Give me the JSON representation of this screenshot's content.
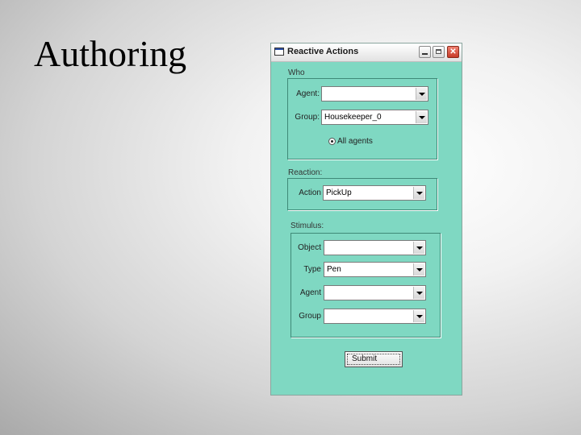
{
  "slide": {
    "title": "Authoring"
  },
  "window": {
    "title": "Reactive Actions",
    "controls": {
      "minimize": "–",
      "maximize": "□",
      "close": "✕"
    }
  },
  "who": {
    "label": "Who",
    "agent_label": "Agent:",
    "agent_value": "",
    "group_label": "Group:",
    "group_value": "Housekeeper_0",
    "all_agents_label": "All agents"
  },
  "reaction": {
    "label": "Reaction:",
    "action_label": "Action",
    "action_value": "PickUp"
  },
  "stimulus": {
    "label": "Stimulus:",
    "object_label": "Object",
    "object_value": "",
    "type_label": "Type",
    "type_value": "Pen",
    "agent_label": "Agent",
    "agent_value": "",
    "group_label": "Group",
    "group_value": ""
  },
  "submit_label": "Submit"
}
